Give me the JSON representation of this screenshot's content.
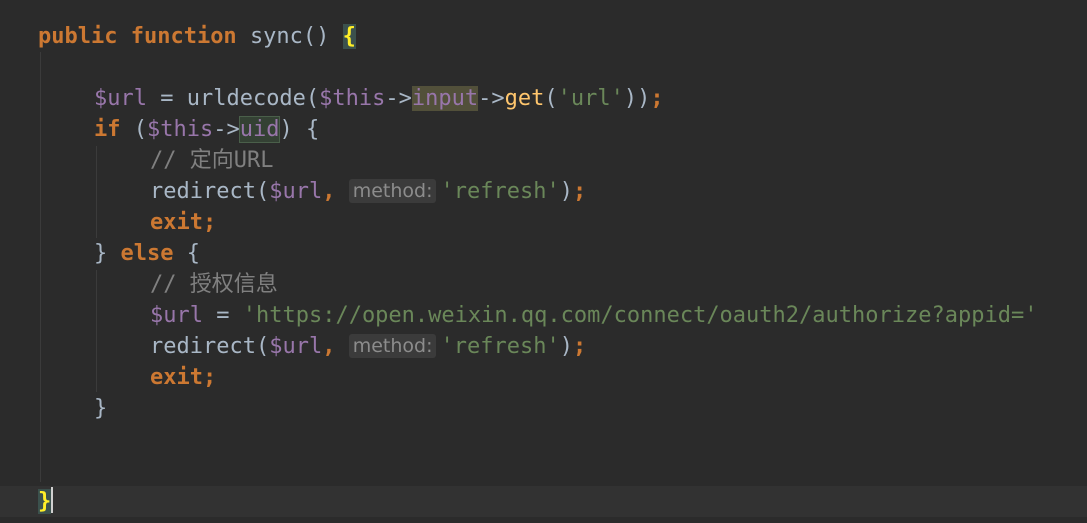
{
  "editor": {
    "lines": [
      {
        "segments": [
          {
            "cls": "kw",
            "text": "public "
          },
          {
            "cls": "kw",
            "text": "function "
          },
          {
            "cls": "plain",
            "text": "sync() "
          },
          {
            "cls": "brace-match",
            "text": "{"
          }
        ]
      },
      {
        "segments": []
      },
      {
        "segments": [
          {
            "cls": "var",
            "text": "$url"
          },
          {
            "cls": "plain",
            "text": " = urldecode("
          },
          {
            "cls": "var",
            "text": "$this"
          },
          {
            "cls": "plain",
            "text": "->"
          },
          {
            "cls": "hl-prop",
            "text": "input"
          },
          {
            "cls": "plain",
            "text": "->"
          },
          {
            "cls": "fn",
            "text": "get"
          },
          {
            "cls": "plain",
            "text": "("
          },
          {
            "cls": "str",
            "text": "'url'"
          },
          {
            "cls": "plain",
            "text": "))"
          },
          {
            "cls": "kw",
            "text": ";"
          }
        ]
      },
      {
        "segments": [
          {
            "cls": "kw",
            "text": "if"
          },
          {
            "cls": "plain",
            "text": " ("
          },
          {
            "cls": "var",
            "text": "$this"
          },
          {
            "cls": "plain",
            "text": "->"
          },
          {
            "cls": "hl-uid",
            "text": "uid"
          },
          {
            "cls": "plain",
            "text": ") {"
          }
        ]
      },
      {
        "segments": [
          {
            "cls": "cmt",
            "text": "// 定向URL"
          }
        ]
      },
      {
        "segments": [
          {
            "cls": "plain",
            "text": "redirect("
          },
          {
            "cls": "var",
            "text": "$url"
          },
          {
            "cls": "kw",
            "text": ", "
          },
          {
            "cls": "hint",
            "text": "method:"
          },
          {
            "cls": "str",
            "text": "'refresh'"
          },
          {
            "cls": "plain",
            "text": ")"
          },
          {
            "cls": "kw",
            "text": ";"
          }
        ]
      },
      {
        "segments": [
          {
            "cls": "kw",
            "text": "exit;"
          }
        ]
      },
      {
        "segments": [
          {
            "cls": "plain",
            "text": "} "
          },
          {
            "cls": "kw",
            "text": "else"
          },
          {
            "cls": "plain",
            "text": " {"
          }
        ]
      },
      {
        "segments": [
          {
            "cls": "cmt",
            "text": "// 授权信息"
          }
        ]
      },
      {
        "segments": [
          {
            "cls": "var",
            "text": "$url"
          },
          {
            "cls": "plain",
            "text": " = "
          },
          {
            "cls": "str",
            "text": "'https://open.weixin.qq.com/connect/oauth2/authorize?appid='"
          }
        ]
      },
      {
        "segments": [
          {
            "cls": "plain",
            "text": "redirect("
          },
          {
            "cls": "var",
            "text": "$url"
          },
          {
            "cls": "kw",
            "text": ", "
          },
          {
            "cls": "hint",
            "text": "method:"
          },
          {
            "cls": "str",
            "text": "'refresh'"
          },
          {
            "cls": "plain",
            "text": ")"
          },
          {
            "cls": "kw",
            "text": ";"
          }
        ]
      },
      {
        "segments": [
          {
            "cls": "kw",
            "text": "exit;"
          }
        ]
      },
      {
        "segments": [
          {
            "cls": "plain",
            "text": "}"
          }
        ]
      },
      {
        "segments": []
      },
      {
        "segments": []
      },
      {
        "segments": [
          {
            "cls": "brace-match",
            "text": "}"
          }
        ]
      }
    ]
  }
}
